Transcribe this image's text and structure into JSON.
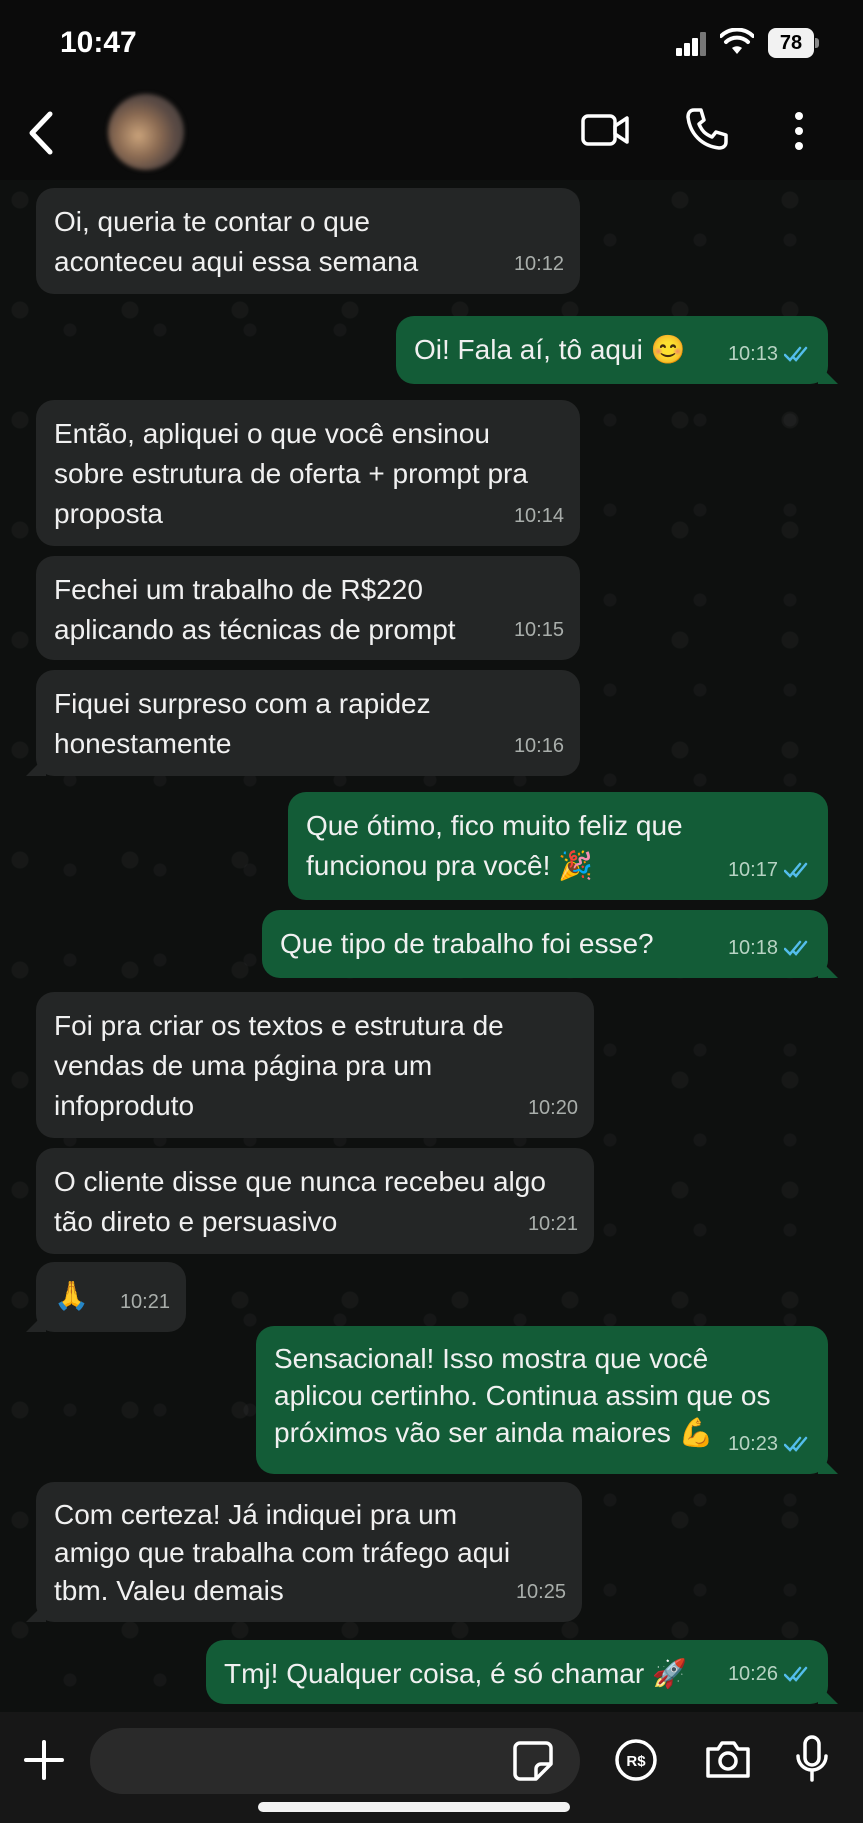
{
  "status_bar": {
    "time": "10:47",
    "battery": "78"
  },
  "header": {
    "contact_avatar_alt": ""
  },
  "messages": [
    {
      "dir": "in",
      "text": "Oi, queria te contar o que aconteceu aqui essa semana",
      "time": "10:12"
    },
    {
      "dir": "out",
      "text": "Oi! Fala aí, tô aqui 😊",
      "time": "10:13",
      "read": true
    },
    {
      "dir": "in",
      "text": "Então, apliquei o que você ensinou sobre estrutura de oferta + prompt pra proposta",
      "time": "10:14"
    },
    {
      "dir": "in",
      "text": "Fechei um trabalho de R$220 aplicando as técnicas de prompt",
      "time": "10:15"
    },
    {
      "dir": "in",
      "text": "Fiquei surpreso com a rapidez honestamente",
      "time": "10:16"
    },
    {
      "dir": "out",
      "text": "Que ótimo, fico muito feliz que funcionou pra você! 🎉",
      "time": "10:17",
      "read": true
    },
    {
      "dir": "out",
      "text": "Que tipo de trabalho foi esse?",
      "time": "10:18",
      "read": true
    },
    {
      "dir": "in",
      "text": "Foi pra criar os textos e estrutura de vendas de uma página pra um infoproduto",
      "time": "10:20"
    },
    {
      "dir": "in",
      "text": "O cliente disse que nunca recebeu algo tão direto e persuasivo",
      "time": "10:21"
    },
    {
      "dir": "in",
      "text": "🙏",
      "time": "10:21"
    },
    {
      "dir": "out",
      "text": "Sensacional! Isso mostra que você aplicou certinho. Continua assim que os próximos vão ser ainda maiores 💪",
      "time": "10:23",
      "read": true
    },
    {
      "dir": "in",
      "text": "Com certeza! Já indiquei pra um amigo que trabalha com tráfego aqui tbm. Valeu demais",
      "time": "10:25"
    },
    {
      "dir": "out",
      "text": "Tmj! Qualquer coisa, é só chamar 🚀",
      "time": "10:26",
      "read": true
    }
  ],
  "compose": {
    "placeholder": "",
    "value": ""
  },
  "colors": {
    "incoming": "#242626",
    "outgoing": "#135c37",
    "read_tick": "#53bdeb"
  }
}
